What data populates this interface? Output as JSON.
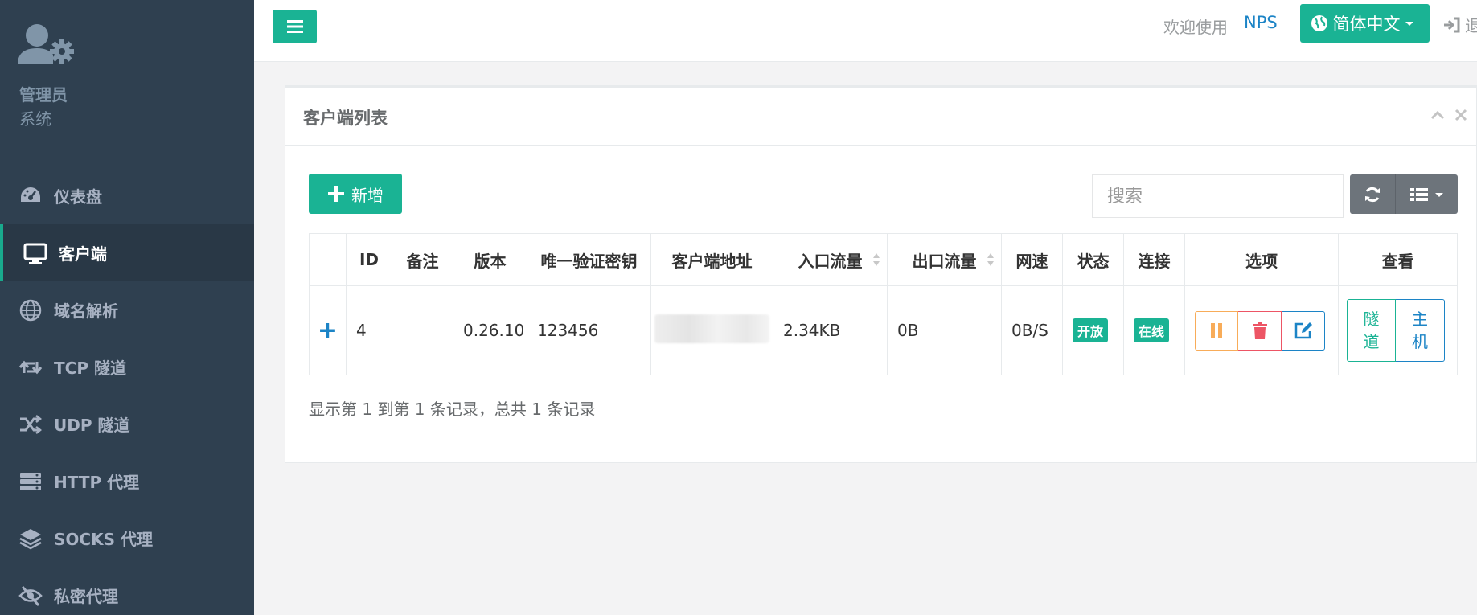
{
  "sidebar": {
    "profile_name": "管理员",
    "profile_role": "系统",
    "items": [
      {
        "label": "仪表盘",
        "icon": "dashboard-icon"
      },
      {
        "label": "客户端",
        "icon": "monitor-icon",
        "active": true
      },
      {
        "label": "域名解析",
        "icon": "globe-icon"
      },
      {
        "label": "TCP 隧道",
        "icon": "retweet-icon"
      },
      {
        "label": "UDP 隧道",
        "icon": "shuffle-icon"
      },
      {
        "label": "HTTP 代理",
        "icon": "server-icon"
      },
      {
        "label": "SOCKS 代理",
        "icon": "layers-icon"
      },
      {
        "label": "私密代理",
        "icon": "eye-slash-icon"
      }
    ]
  },
  "topbar": {
    "welcome": "欢迎使用",
    "brand": "NPS",
    "language": "简体中文",
    "logout": "退出"
  },
  "panel": {
    "title": "客户端列表",
    "add_label": "新增",
    "search_placeholder": "搜索",
    "summary": "显示第 1 到第 1 条记录，总共 1 条记录"
  },
  "table": {
    "columns": [
      "",
      "ID",
      "备注",
      "版本",
      "唯一验证密钥",
      "客户端地址",
      "入口流量",
      "出口流量",
      "网速",
      "状态",
      "连接",
      "选项",
      "查看"
    ],
    "rows": [
      {
        "id": "4",
        "remark": "",
        "version": "0.26.10",
        "key": "123456",
        "address": "",
        "in_flow": "2.34KB",
        "out_flow": "0B",
        "speed": "0B/S",
        "status": "开放",
        "connection": "在线",
        "view_tunnel": "隧道",
        "view_host": "主机"
      }
    ]
  },
  "colors": {
    "sidebar_bg": "#2f4050",
    "primary": "#1ab394",
    "info": "#1c84c6",
    "warning": "#f8ac59",
    "danger": "#ed5565"
  }
}
